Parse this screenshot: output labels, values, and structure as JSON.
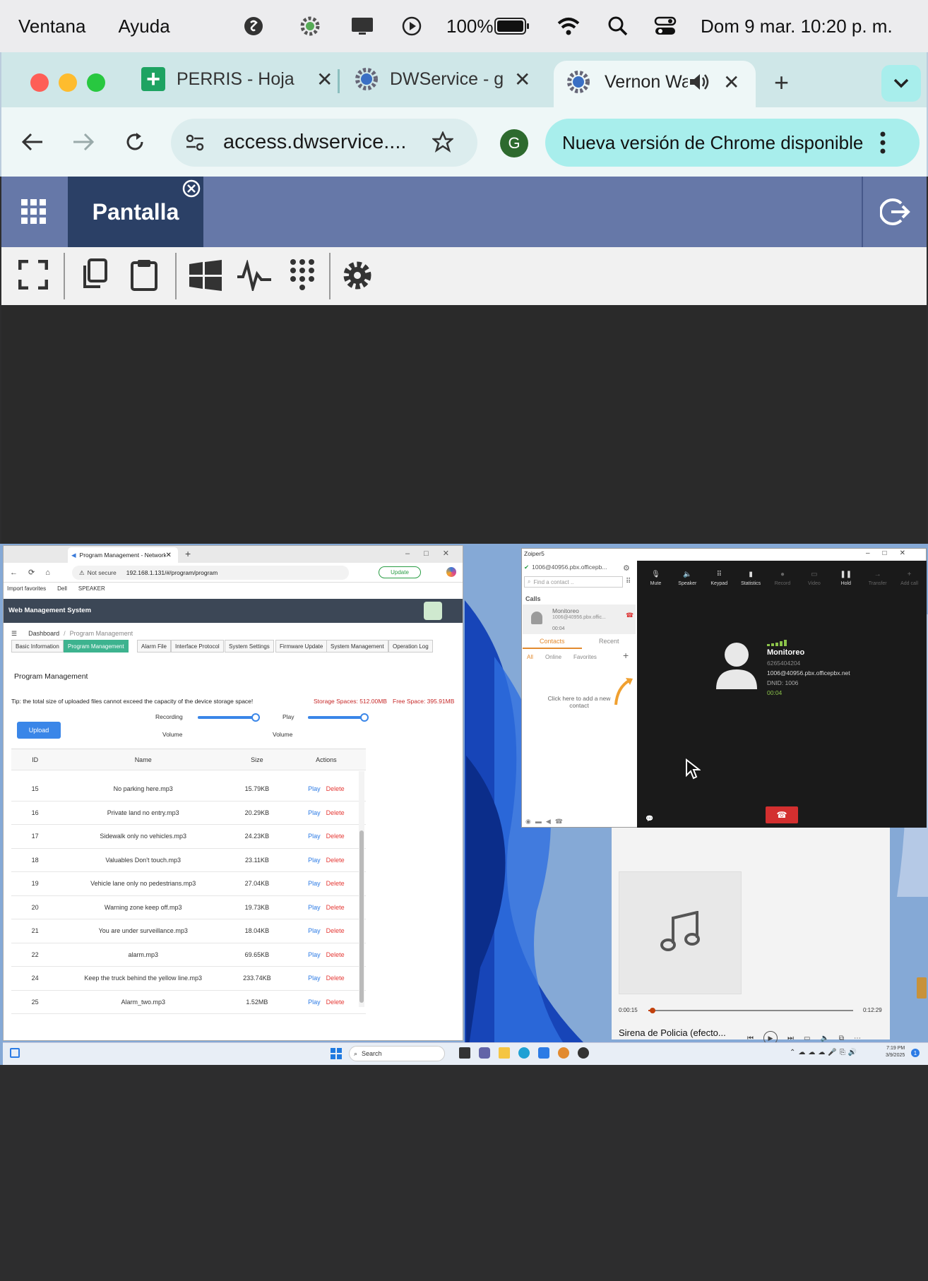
{
  "menubar": {
    "items": [
      "Ventana",
      "Ayuda"
    ],
    "battery": "100%",
    "datetime": "Dom 9 mar.  10:20 p. m."
  },
  "chrome": {
    "tabs": [
      {
        "label": "PERRIS - Hoja"
      },
      {
        "label": "DWService - g"
      },
      {
        "label": "Vernon Wa"
      }
    ],
    "address": "access.dwservice....",
    "profile_initial": "G",
    "update_label": "Nueva versión de Chrome disponible"
  },
  "dwservice": {
    "tab_label": "Pantalla"
  },
  "edge": {
    "tab_label": "Program Management - Network",
    "not_secure": "Not secure",
    "url": "192.168.1.131/#/program/program",
    "update": "Update",
    "favorites": [
      "Import favorites",
      "Dell",
      "SPEAKER"
    ],
    "app_title": "Web Management System",
    "breadcrumb": {
      "root": "Dashboard",
      "sep": "/",
      "current": "Program Management"
    },
    "nav_tabs": [
      "Basic Information",
      "Program Management",
      "Alarm File",
      "Interface Protocol",
      "System Settings",
      "Firmware Update",
      "System Management",
      "Operation Log"
    ],
    "section_title": "Program Management",
    "tip": "Tip: the total size of uploaded files cannot exceed the capacity of the device storage space!",
    "storage": "Storage Spaces: 512.00MB",
    "free": "Free Space: 395.91MB",
    "upload": "Upload",
    "recording_volume": [
      "Recording",
      "Volume"
    ],
    "play_volume": [
      "Play",
      "Volume"
    ],
    "recording_level": 0.95,
    "play_level": 0.95,
    "table": {
      "headers": [
        "ID",
        "Name",
        "Size",
        "Actions"
      ],
      "play": "Play",
      "delete": "Delete",
      "rows": [
        {
          "id": "15",
          "name": "No parking here.mp3",
          "size": "15.79KB"
        },
        {
          "id": "16",
          "name": "Private land no entry.mp3",
          "size": "20.29KB"
        },
        {
          "id": "17",
          "name": "Sidewalk only no vehicles.mp3",
          "size": "24.23KB"
        },
        {
          "id": "18",
          "name": "Valuables Don't touch.mp3",
          "size": "23.11KB"
        },
        {
          "id": "19",
          "name": "Vehicle lane only no pedestrians.mp3",
          "size": "27.04KB"
        },
        {
          "id": "20",
          "name": "Warning zone keep off.mp3",
          "size": "19.73KB"
        },
        {
          "id": "21",
          "name": "You are under surveillance.mp3",
          "size": "18.04KB"
        },
        {
          "id": "22",
          "name": "alarm.mp3",
          "size": "69.65KB"
        },
        {
          "id": "24",
          "name": "Keep the truck behind the yellow line.mp3",
          "size": "233.74KB"
        },
        {
          "id": "25",
          "name": "Alarm_two.mp3",
          "size": "1.52MB"
        }
      ]
    }
  },
  "zoiper": {
    "title": "Zoiper5",
    "account": "1006@40956.pbx.officepb...",
    "search_placeholder": "Find a contact ..",
    "calls_label": "Calls",
    "call_item": {
      "name": "Monitoreo",
      "sub": "1006@40956.pbx.offic...",
      "time": "00:04"
    },
    "tabs": [
      "Contacts",
      "Recent"
    ],
    "filters": [
      "All",
      "Online",
      "Favorites"
    ],
    "add_contact": "Click here to add a new contact",
    "toolbar": [
      "Mute",
      "Speaker",
      "Keypad",
      "Statistics",
      "Record",
      "Video",
      "Hold",
      "Transfer",
      "Add call"
    ],
    "caller": {
      "name": "Monitoreo",
      "number": "6265404204",
      "uri": "1006@40956.pbx.officepbx.net",
      "dnid": "DNID: 1006",
      "time": "00:04"
    }
  },
  "media": {
    "elapsed": "0:00:15",
    "total": "0:12:29",
    "title": "Sirena de Policia (efecto...",
    "progress": 0.02
  },
  "taskbar": {
    "search": "Search",
    "time": "7:19 PM",
    "date": "3/9/2025",
    "notif": "1"
  }
}
